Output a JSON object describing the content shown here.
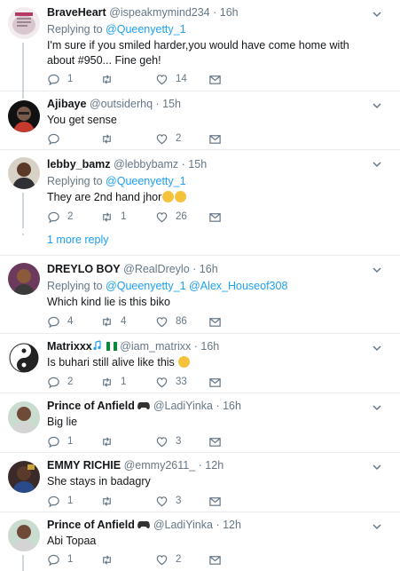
{
  "tweets": [
    {
      "name": "BraveHeart",
      "handle": "@ispeakmymind234",
      "time": "· 16h",
      "reply_prefix": "Replying to",
      "reply_mentions": [
        "@Queenyetty_1"
      ],
      "text": "I'm sure if you smiled harder,you would have come home with about #950... Fine geh!",
      "replies": "1",
      "retweets": "",
      "likes": "14",
      "avatar_icon": "braveheart-avatar"
    },
    {
      "name": "Ajibaye",
      "handle": "@outsiderhq",
      "time": "· 15h",
      "text": "You get sense",
      "replies": "",
      "retweets": "",
      "likes": "2",
      "avatar_icon": "ajibaye-avatar"
    },
    {
      "name": "lebby_bamz",
      "handle": "@lebbybamz",
      "time": "· 15h",
      "reply_prefix": "Replying to",
      "reply_mentions": [
        "@Queenyetty_1"
      ],
      "text": "They are 2nd hand jhor",
      "replies": "2",
      "retweets": "1",
      "likes": "26",
      "more_replies": "1 more reply",
      "avatar_icon": "lebby-avatar"
    },
    {
      "name": "DREYLO BOY",
      "handle": "@RealDreylo",
      "time": "· 16h",
      "reply_prefix": "Replying to",
      "reply_mentions": [
        "@Queenyetty_1",
        "@Alex_Houseof308"
      ],
      "text": "Which kind lie is this biko",
      "replies": "4",
      "retweets": "4",
      "likes": "86",
      "avatar_icon": "dreylo-avatar"
    },
    {
      "name": "Matrixxx",
      "handle": "@iam_matrixx",
      "time": "· 16h",
      "text": "Is buhari still alive like this",
      "replies": "2",
      "retweets": "1",
      "likes": "33",
      "avatar_icon": "yin-yang-avatar"
    },
    {
      "name": "Prince of Anfield",
      "handle": "@LadiYinka",
      "time": "· 16h",
      "text": "Big lie",
      "replies": "1",
      "retweets": "",
      "likes": "3",
      "avatar_icon": "prince-avatar"
    },
    {
      "name": "EMMY RICHIE",
      "handle": "@emmy2611_",
      "time": "· 12h",
      "text": "She stays in badagry",
      "replies": "1",
      "retweets": "",
      "likes": "3",
      "avatar_icon": "emmy-avatar"
    },
    {
      "name": "Prince of Anfield",
      "handle": "@LadiYinka",
      "time": "· 12h",
      "text": "Abi Topaa",
      "replies": "1",
      "retweets": "",
      "likes": "2",
      "avatar_icon": "prince-avatar"
    }
  ],
  "colors": {
    "link": "#1da1f2",
    "muted": "#657786",
    "divider": "#e6ecf0",
    "thread_line": "#ccd6dd"
  },
  "icons": {
    "reply": "reply-icon",
    "retweet": "retweet-icon",
    "like": "heart-icon",
    "dm": "envelope-icon",
    "menu": "chevron-down-icon",
    "controller": "game-controller-icon",
    "music": "music-notes-icon",
    "flag": "nigeria-flag-icon"
  }
}
